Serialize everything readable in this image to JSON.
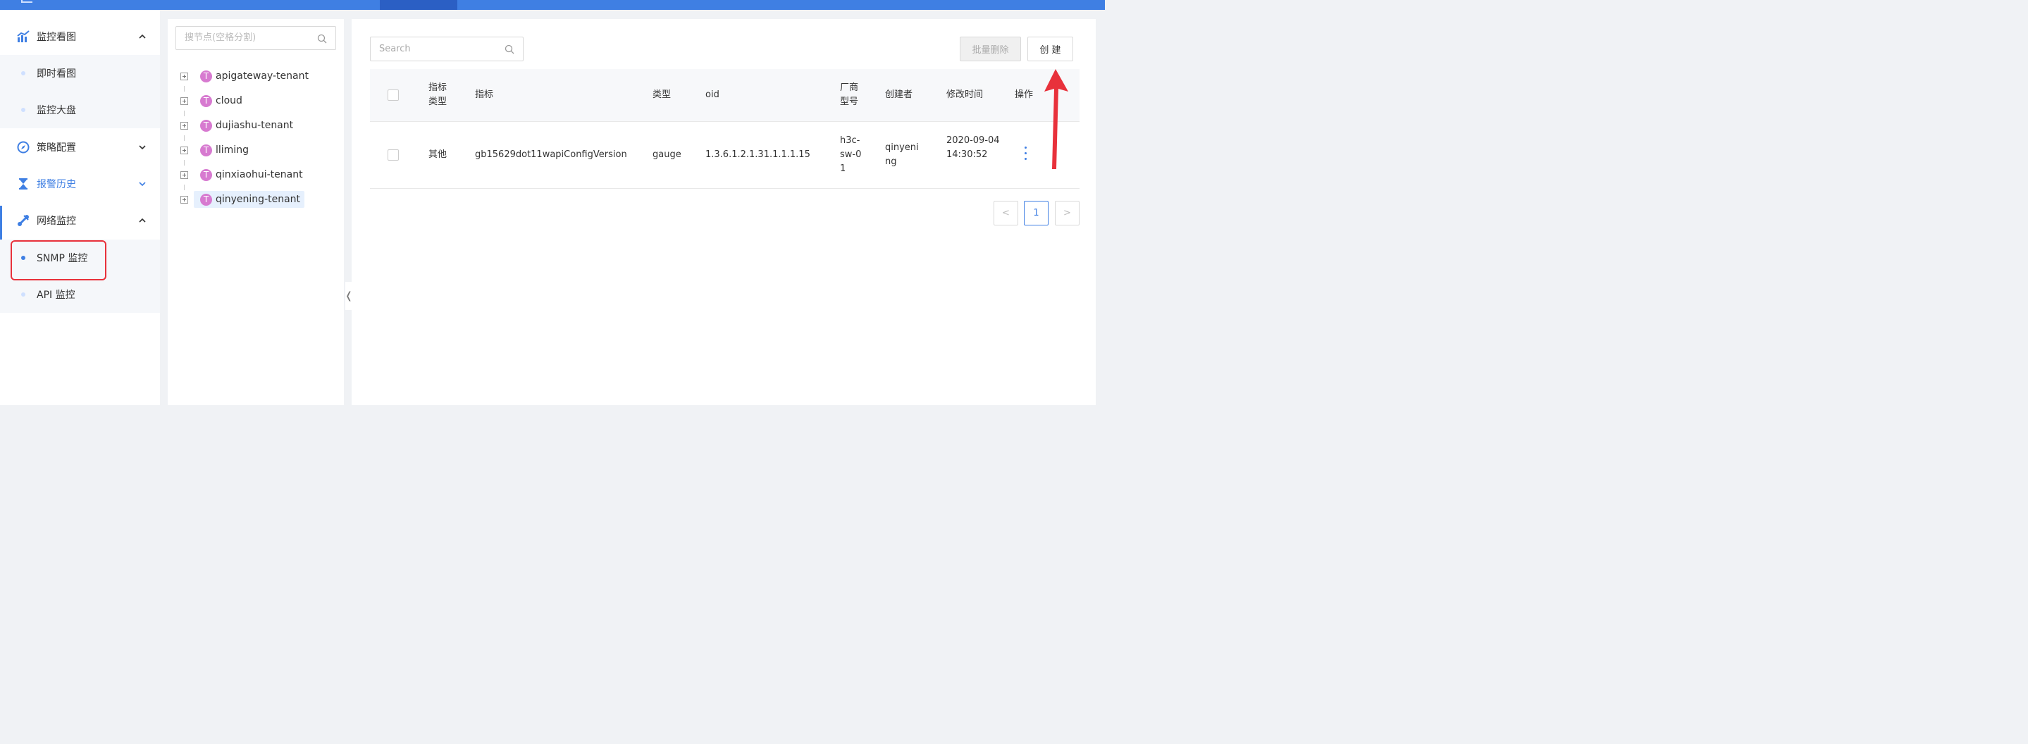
{
  "sidebar": {
    "groups": [
      {
        "label": "监控看图",
        "icon": "chart-icon",
        "expanded": true
      },
      {
        "label": "策略配置",
        "icon": "compass-icon",
        "expanded": false
      },
      {
        "label": "报警历史",
        "icon": "hourglass-icon",
        "expanded": false
      },
      {
        "label": "网络监控",
        "icon": "network-icon",
        "expanded": true
      }
    ],
    "monitor_items": [
      "即时看图",
      "监控大盘"
    ],
    "network_items": [
      "SNMP 监控",
      "API 监控"
    ]
  },
  "tree": {
    "search_placeholder": "搜节点(空格分割)",
    "nodes": [
      {
        "badge": "T",
        "label": "apigateway-tenant"
      },
      {
        "badge": "T",
        "label": "cloud"
      },
      {
        "badge": "T",
        "label": "dujiashu-tenant"
      },
      {
        "badge": "T",
        "label": "lliming"
      },
      {
        "badge": "T",
        "label": "qinxiaohui-tenant"
      },
      {
        "badge": "T",
        "label": "qinyening-tenant"
      }
    ],
    "collapse_glyph": "❬"
  },
  "main": {
    "search_placeholder": "Search",
    "batch_delete_label": "批量删除",
    "create_label": "创 建",
    "columns": {
      "metric_type": "指标类型",
      "metric": "指标",
      "type": "类型",
      "oid": "oid",
      "vendor_model": "厂商型号",
      "creator": "创建者",
      "modified": "修改时间",
      "actions": "操作"
    },
    "rows": [
      {
        "metric_type": "其他",
        "metric": "gb15629dot11wapiConfigVersion",
        "type": "gauge",
        "oid": "1.3.6.1.2.1.31.1.1.1.15",
        "vendor_model": "h3c-sw-01",
        "creator": "qinyening",
        "modified": "2020-09-04 14:30:52"
      }
    ],
    "pagination": {
      "prev": "<",
      "current": "1",
      "next": ">"
    }
  },
  "colors": {
    "accent": "#3f7fe3",
    "highlight": "#e8313b",
    "badge": "#d77ad0"
  }
}
